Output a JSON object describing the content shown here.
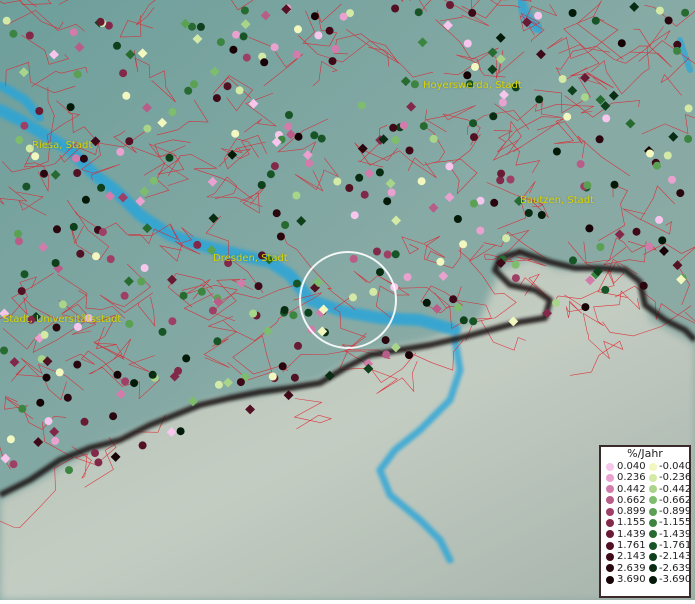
{
  "map": {
    "places": [
      {
        "id": "hoyerswerda",
        "label": "Hoyerswerda, Stadt"
      },
      {
        "id": "riesa",
        "label": "Riesa, Stadt"
      },
      {
        "id": "bautzen",
        "label": "Bautzen, Stadt"
      },
      {
        "id": "dresden",
        "label": "Dresden, Stadt"
      },
      {
        "id": "freiberg",
        "label": "Stadt, Universitätsstadt"
      }
    ],
    "label_color": "#d8d400",
    "boundary_color": "#e0202a",
    "river_color": "#2aa5d8",
    "terrain_color": "#7fa8a4",
    "highlight_circle": true
  },
  "legend": {
    "title": "%/Jahr",
    "positive": [
      {
        "value": "0.040",
        "color": "#f7c6ec"
      },
      {
        "value": "0.236",
        "color": "#e9a2cf"
      },
      {
        "value": "0.442",
        "color": "#d27cab"
      },
      {
        "value": "0.662",
        "color": "#b85c88"
      },
      {
        "value": "0.899",
        "color": "#9e3f66"
      },
      {
        "value": "1.155",
        "color": "#82294a"
      },
      {
        "value": "1.439",
        "color": "#6a1b34"
      },
      {
        "value": "1.761",
        "color": "#531124"
      },
      {
        "value": "2.143",
        "color": "#3e0a17"
      },
      {
        "value": "2.639",
        "color": "#2a060e"
      },
      {
        "value": "3.690",
        "color": "#170306"
      }
    ],
    "negative": [
      {
        "value": "-0.040",
        "color": "#f1f7bf"
      },
      {
        "value": "-0.236",
        "color": "#d2eaa5"
      },
      {
        "value": "-0.442",
        "color": "#a9d58a"
      },
      {
        "value": "-0.662",
        "color": "#7ebd6d"
      },
      {
        "value": "-0.899",
        "color": "#5aa153"
      },
      {
        "value": "-1.155",
        "color": "#3c8540"
      },
      {
        "value": "-1.439",
        "color": "#276b31"
      },
      {
        "value": "-1.761",
        "color": "#185526"
      },
      {
        "value": "-2.143",
        "color": "#0e401b"
      },
      {
        "value": "-2.639",
        "color": "#082d12"
      },
      {
        "value": "-3.690",
        "color": "#031a09"
      }
    ]
  }
}
